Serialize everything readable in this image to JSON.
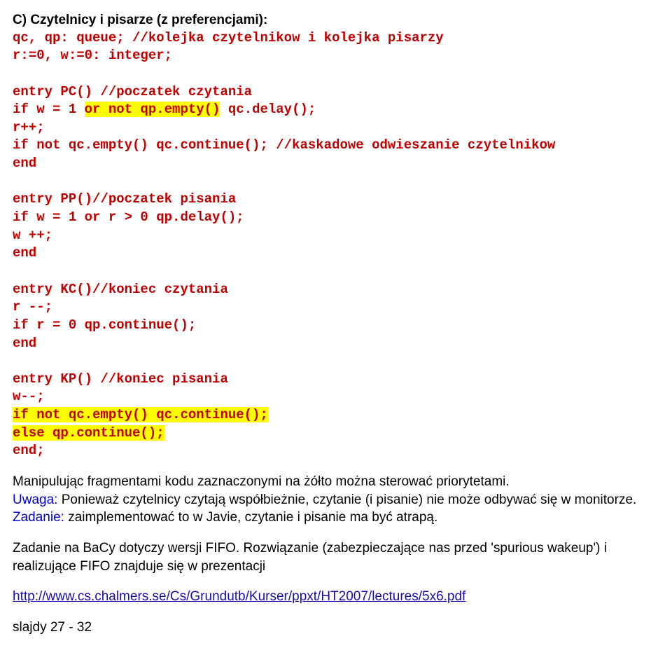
{
  "heading": "C) Czytelnicy i pisarze (z preferencjami):",
  "code": {
    "l1": "qc, qp: queue; //kolejka czytelnikow i kolejka pisarzy",
    "l2": "r:=0, w:=0: integer;",
    "l3": "entry PC() //poczatek czytania",
    "l4a": "if w = 1 ",
    "l4h": "or not qp.empty()",
    "l4b": " qc.delay();",
    "l5": "r++;",
    "l6": "if not qc.empty() qc.continue(); //kaskadowe odwieszanie czytelnikow",
    "l7": "end",
    "l8": "entry PP()//poczatek pisania",
    "l9": "if w = 1 or r > 0 qp.delay();",
    "l10": "w ++;",
    "l11": "end",
    "l12": "entry KC()//koniec czytania",
    "l13": "r --;",
    "l14": "if r = 0 qp.continue();",
    "l15": "end",
    "l16": "entry KP() //koniec pisania",
    "l17": "w--;",
    "l18h": "if not qc.empty() qc.continue();",
    "l19h": "else qp.continue();",
    "l20": "end;"
  },
  "p1": "Manipulując fragmentami kodu zaznaczonymi na żółto można sterować priorytetami.",
  "p2a": "Uwaga:",
  "p2b": " Ponieważ czytelnicy czytają współbieżnie, czytanie (i pisanie) nie może odbywać się w monitorze.",
  "p3a": "Zadanie:",
  "p3b": " zaimplementować to w Javie, czytanie i pisanie ma być atrapą.",
  "p4": "Zadanie na BaCy dotyczy wersji FIFO. Rozwiązanie (zabezpieczające nas przed 'spurious wakeup') i realizujące FIFO znajduje się w prezentacji",
  "link": "http://www.cs.chalmers.se/Cs/Grundutb/Kurser/ppxt/HT2007/lectures/5x6.pdf",
  "p5": "slajdy 27 - 32"
}
